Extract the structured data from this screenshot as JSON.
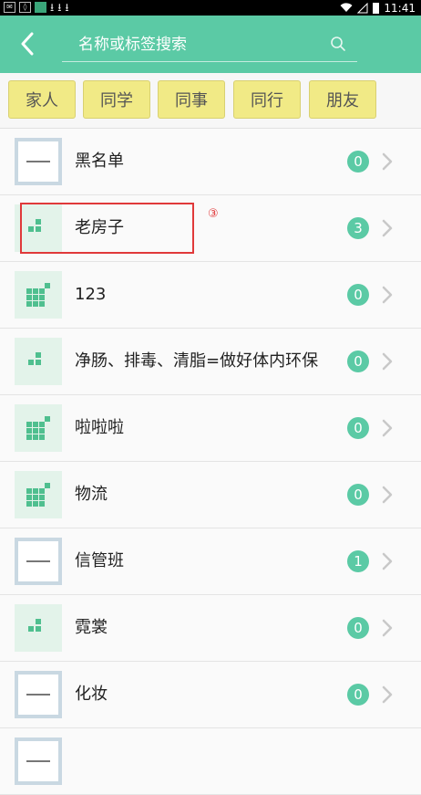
{
  "status_bar": {
    "time": "11:41",
    "left_icons": [
      "wechat-icon",
      "shield-icon",
      "app-icon",
      "download-icon",
      "download-icon",
      "download-icon"
    ],
    "right_icons": [
      "wifi-icon",
      "signal-icon",
      "battery-icon"
    ]
  },
  "header": {
    "back_icon": "chevron-left-icon",
    "search_placeholder": "名称或标签搜索",
    "search_icon": "search-icon",
    "accent_color": "#5bcaa5"
  },
  "tags": [
    "家人",
    "同学",
    "同事",
    "同行",
    "朋友"
  ],
  "list": [
    {
      "label": "黑名单",
      "count": "0",
      "thumb": "poster"
    },
    {
      "label": "老房子",
      "count": "3",
      "thumb": "grid-small"
    },
    {
      "label": "123",
      "count": "0",
      "thumb": "grid-large"
    },
    {
      "label": "净肠、排毒、清脂=做好体内环保",
      "count": "0",
      "thumb": "grid-small"
    },
    {
      "label": "啦啦啦",
      "count": "0",
      "thumb": "grid-large"
    },
    {
      "label": "物流",
      "count": "0",
      "thumb": "grid-large"
    },
    {
      "label": "信管班",
      "count": "1",
      "thumb": "poster"
    },
    {
      "label": "霓裳",
      "count": "0",
      "thumb": "grid-small"
    },
    {
      "label": "化妆",
      "count": "0",
      "thumb": "poster"
    }
  ],
  "annotation": {
    "marker": "③",
    "color": "#e0393a"
  }
}
